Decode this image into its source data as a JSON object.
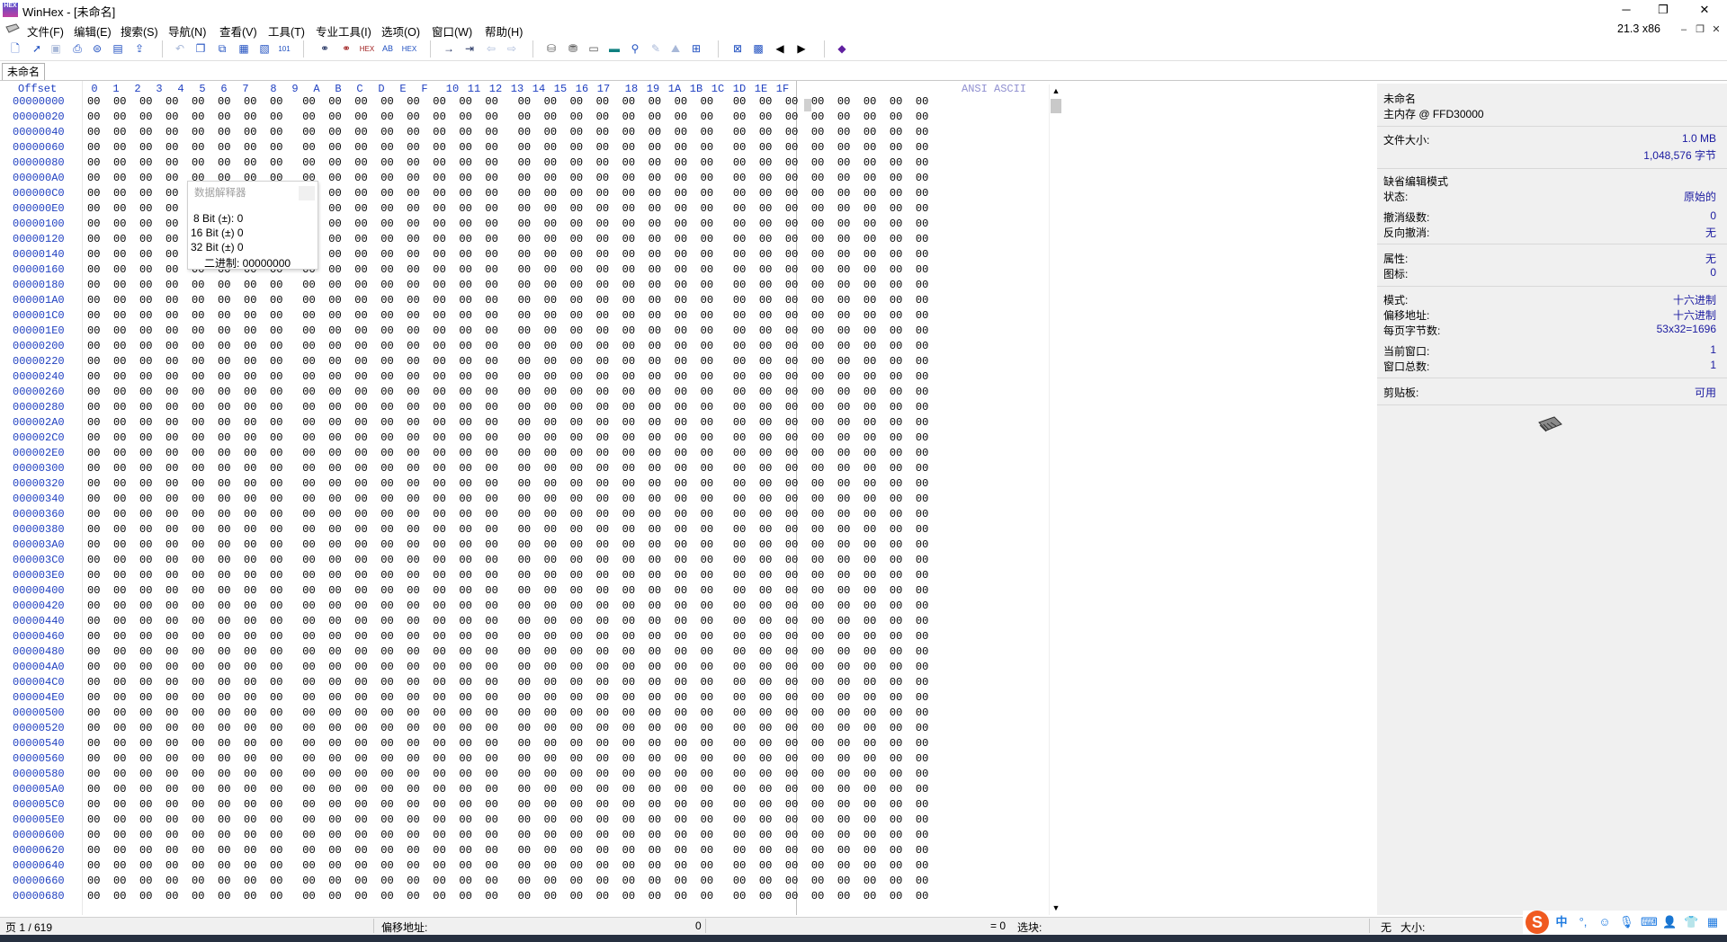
{
  "window": {
    "title": "WinHex - [未命名]",
    "version": "21.3 x86",
    "minimize_glyph": "─",
    "maximize_glyph": "❐",
    "close_glyph": "✕",
    "mdi_min_glyph": "–",
    "mdi_restore_glyph": "❐",
    "mdi_close_glyph": "✕"
  },
  "menu": {
    "items": [
      "文件(F)",
      "编辑(E)",
      "搜索(S)",
      "导航(N)",
      "查看(V)",
      "工具(T)",
      "专业工具(I)",
      "选项(O)",
      "窗口(W)",
      "帮助(H)"
    ]
  },
  "toolbar": {
    "icons": [
      "new-file-icon",
      "open-file-icon",
      "save-icon",
      "print-icon",
      "properties-icon",
      "copy-doc-icon",
      "export-icon",
      "undo-icon",
      "copy-icon",
      "copy-block-icon",
      "paste-icon",
      "paste-special-icon",
      "binary-icon",
      "find-icon",
      "find-replace-icon",
      "find-hex-icon",
      "replace-text-icon",
      "replace-hex-icon",
      "goto-icon",
      "goto-offset-icon",
      "back-icon",
      "forward-icon",
      "open-disk-icon",
      "disk-write-icon",
      "ram-icon",
      "hash-icon",
      "search-icon",
      "tools-icon",
      "options-icon",
      "calc-icon",
      "view-icon",
      "layout-icon",
      "prev-icon",
      "next-icon",
      "book-icon"
    ]
  },
  "tab": {
    "label": "未命名"
  },
  "hex": {
    "offset_header": "Offset",
    "columns": [
      "0",
      "1",
      "2",
      "3",
      "4",
      "5",
      "6",
      "7",
      "8",
      "9",
      "A",
      "B",
      "C",
      "D",
      "E",
      "F",
      "10",
      "11",
      "12",
      "13",
      "14",
      "15",
      "16",
      "17",
      "18",
      "19",
      "1A",
      "1B",
      "1C",
      "1D",
      "1E",
      "1F"
    ],
    "ascii_header": "ANSI ASCII",
    "byte_value": "00",
    "offsets": [
      "00000000",
      "00000020",
      "00000040",
      "00000060",
      "00000080",
      "000000A0",
      "000000C0",
      "000000E0",
      "00000100",
      "00000120",
      "00000140",
      "00000160",
      "00000180",
      "000001A0",
      "000001C0",
      "000001E0",
      "00000200",
      "00000220",
      "00000240",
      "00000260",
      "00000280",
      "000002A0",
      "000002C0",
      "000002E0",
      "00000300",
      "00000320",
      "00000340",
      "00000360",
      "00000380",
      "000003A0",
      "000003C0",
      "000003E0",
      "00000400",
      "00000420",
      "00000440",
      "00000460",
      "00000480",
      "000004A0",
      "000004C0",
      "000004E0",
      "00000500",
      "00000520",
      "00000540",
      "00000560",
      "00000580",
      "000005A0",
      "000005C0",
      "000005E0",
      "00000600",
      "00000620",
      "00000640",
      "00000660",
      "00000680"
    ]
  },
  "interpreter": {
    "title": "数据解释器",
    "lines": [
      "8 Bit (±): 0",
      "16 Bit (±) 0",
      "32 Bit (±) 0",
      "二进制: 00000000"
    ]
  },
  "info": {
    "name": "未命名",
    "location": "主内存 @ FFD30000",
    "file_size_label": "文件大小:",
    "file_size_mb": "1.0 MB",
    "file_size_bytes": "1,048,576 字节",
    "edit_mode": "缺省编辑模式",
    "state_label": "状态:",
    "state_value": "原始的",
    "undo_label": "撤消级数:",
    "undo_value": "0",
    "reverse_undo_label": "反向撤消:",
    "reverse_undo_value": "无",
    "attr_label": "属性:",
    "attr_value": "无",
    "icon_label": "图标:",
    "icon_value": "0",
    "mode_label": "模式:",
    "mode_value": "十六进制",
    "offset_label": "偏移地址:",
    "offset_value": "十六进制",
    "bytes_per_page_label": "每页字节数:",
    "bytes_per_page_value": "53x32=1696",
    "current_window_label": "当前窗口:",
    "current_window_value": "1",
    "total_windows_label": "窗口总数:",
    "total_windows_value": "1",
    "clipboard_label": "剪贴板:",
    "clipboard_value": "可用",
    "chip_icon": "ram-chip-icon"
  },
  "status": {
    "page": "页 1 / 619",
    "offset_label": "偏移地址:",
    "offset_value": "0",
    "eq_value": "= 0",
    "selection_label": "选块:",
    "none_label": "无",
    "size_label": "大小:"
  },
  "ime": {
    "logo": "S",
    "lang": "中",
    "icons": [
      "punctuation-icon",
      "emoji-icon",
      "voice-icon",
      "keyboard-icon",
      "user-icon",
      "skin-icon",
      "grid-icon"
    ]
  }
}
